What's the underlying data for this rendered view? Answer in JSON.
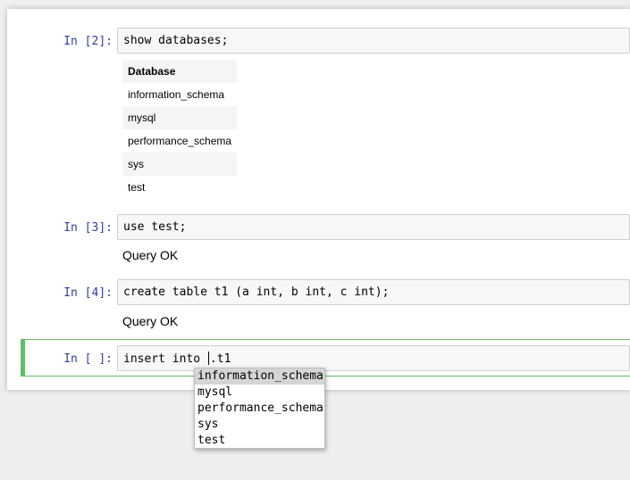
{
  "cells": [
    {
      "prompt": "In [2]:",
      "code": "show databases;"
    },
    {
      "prompt": "In [3]:",
      "code": "use test;",
      "output": "Query OK"
    },
    {
      "prompt": "In [4]:",
      "code": "create table t1 (a int, b int, c int);",
      "output": "Query OK"
    },
    {
      "prompt": "In [ ]:",
      "code_before_cursor": "insert into ",
      "code_after_cursor": ".t1"
    }
  ],
  "result_table": {
    "header": "Database",
    "rows": [
      "information_schema",
      "mysql",
      "performance_schema",
      "sys",
      "test"
    ]
  },
  "autocomplete": {
    "options": [
      "information_schema",
      "mysql",
      "performance_schema",
      "sys",
      "test"
    ],
    "selected": "information_schema"
  },
  "colors": {
    "prompt": "#303f9f",
    "selected_border": "#66bb6a"
  }
}
